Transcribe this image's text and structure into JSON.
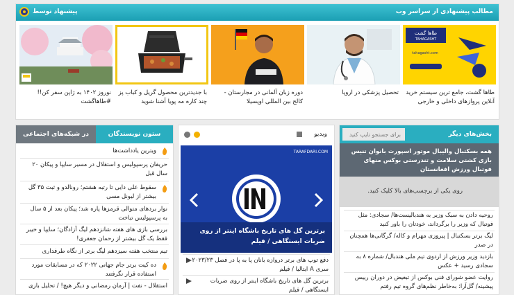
{
  "top_widget": {
    "title": "مطالب پیشنهادی از سراسر وب",
    "sponsor": "پیشنهاد توسط",
    "cards": [
      {
        "caption": "طاها گشت، جامع ترین سیستم خرید آنلاین پروازهای داخلی و خارجی",
        "logo_text": "طاها گشت",
        "logo_sub": "TAHAGASHT",
        "site": "tahagasht.com"
      },
      {
        "caption": "تحصیل پزشکی در اروپا"
      },
      {
        "caption": "دوره زبان آلمانی در مجارستان - کالج بین المللی اوپسیلا"
      },
      {
        "caption": "با جدیدترین محصول گریل و کباب پز چند کاره مه پویا آشنا شوید"
      },
      {
        "caption": "نوروز ۱۴۰۲ به ژاپن سفر کن!! #طاهاگشت"
      }
    ]
  },
  "colors": {
    "teal": "#2aaec0",
    "yellow": "#f2c613",
    "blue": "#1b3fa6"
  },
  "sections": {
    "header": "بخش‌های دیگر",
    "search_placeholder": "برای جستجو تایپ کنید",
    "tags": "همه بسکتبال والیبال موتور اسپورت بانوان تنیس بازی کشتی سلامت و تندرستی بوکس منهای فوتبال ورزش افغانستان",
    "hint": "روی یکی از برچسب‌های بالا کلیک کنید.",
    "items": [
      "روحیه دادن به سبک وزیر به هندبالیست‌ها/ سجادی: مثل فوتبال که وزیر را برگرداند، خودتان را باور کنید",
      "لیگ برتر بسکتبال | پیروزی مهرام و کاله/ گرگانی‌ها همچنان در صدر",
      "بازدید وزیر ورزش از اردوی تیم ملی هندبال/ شماره ۸ به سجادی رسید + عکس",
      "روایت عضو شورای فنی بوکس از تبعیض در دوران رییس پیشینه/ گل‌آرا: به‌خاطر نظم‌های گروه تیم رفتم"
    ]
  },
  "video": {
    "label": "ویدیو",
    "watermark": "TARAFDARI.COM",
    "slide_caption": "برترین گل های تاریخ باشگاه اینتر از روی ضربات ایستگاهی / فیلم",
    "items": [
      "دفع توپ های برتر دروازه بانان پا به پا در فصل ۲۰۲۳/۲۳ سری A ایتالیا / فیلم",
      "برترین گل های تاریخ باشگاه اینتر از روی ضربات ایستگاهی / فیلم"
    ]
  },
  "columns": {
    "tab_active": "ستون نویسندگان",
    "tab_inactive": "در شبکه‌های اجتماعی",
    "items": [
      "ویترین یادداشت‌ها",
      "حریفان پرسپولیس و استقلال در مسیر سایپا و پیکان ۲۰ سال قبل",
      "سقوط علی دایی تا رتبه هشتم؛ رونالدو و ثبت ۳۵ گل بیشتر از لیونل مسی",
      "نوار بردهای متوالی قرمزها پاره شد؛ پیکان بعد از ۵ سال به پرسپولیس تباخت",
      "بررسی بازی های هفته شانزدهم لیگ آزادگان؛ سایپا و خیبر فقط یک گل بیشتر از رحمان جعفری!",
      "تیم منتخب هفته سیزدهم لیگ برتر از نگاه طرفداری",
      "ده کیت برتر جام جهانی ۲۰۲۲ که در مسابقات مورد استفاده قرار نگرفتند",
      "استقلال - نفت | آرمان رمضانی و دیگر هیچ! / تحلیل بازی"
    ]
  }
}
